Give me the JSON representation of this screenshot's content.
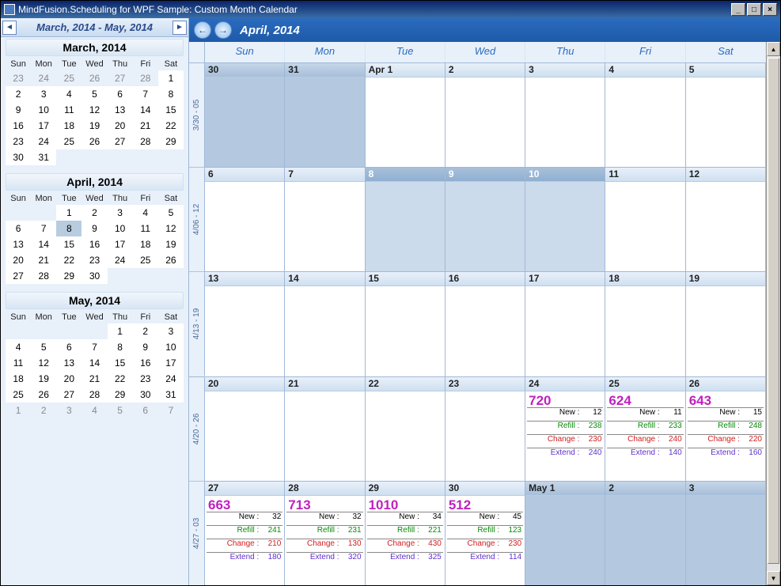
{
  "window": {
    "title": "MindFusion.Scheduling for WPF Sample: Custom Month Calendar"
  },
  "sidebar": {
    "range": "March, 2014 - May, 2014",
    "dow": [
      "Sun",
      "Mon",
      "Tue",
      "Wed",
      "Thu",
      "Fri",
      "Sat"
    ],
    "months": [
      {
        "title": "March, 2014",
        "days": [
          {
            "n": "23",
            "in": false
          },
          {
            "n": "24",
            "in": false
          },
          {
            "n": "25",
            "in": false
          },
          {
            "n": "26",
            "in": false
          },
          {
            "n": "27",
            "in": false
          },
          {
            "n": "28",
            "in": false
          },
          {
            "n": "1",
            "in": true
          },
          {
            "n": "2",
            "in": true
          },
          {
            "n": "3",
            "in": true
          },
          {
            "n": "4",
            "in": true
          },
          {
            "n": "5",
            "in": true
          },
          {
            "n": "6",
            "in": true
          },
          {
            "n": "7",
            "in": true
          },
          {
            "n": "8",
            "in": true
          },
          {
            "n": "9",
            "in": true
          },
          {
            "n": "10",
            "in": true
          },
          {
            "n": "11",
            "in": true
          },
          {
            "n": "12",
            "in": true
          },
          {
            "n": "13",
            "in": true
          },
          {
            "n": "14",
            "in": true
          },
          {
            "n": "15",
            "in": true
          },
          {
            "n": "16",
            "in": true
          },
          {
            "n": "17",
            "in": true
          },
          {
            "n": "18",
            "in": true
          },
          {
            "n": "19",
            "in": true
          },
          {
            "n": "20",
            "in": true
          },
          {
            "n": "21",
            "in": true
          },
          {
            "n": "22",
            "in": true
          },
          {
            "n": "23",
            "in": true
          },
          {
            "n": "24",
            "in": true
          },
          {
            "n": "25",
            "in": true
          },
          {
            "n": "26",
            "in": true
          },
          {
            "n": "27",
            "in": true
          },
          {
            "n": "28",
            "in": true
          },
          {
            "n": "29",
            "in": true
          },
          {
            "n": "30",
            "in": true
          },
          {
            "n": "31",
            "in": true
          },
          {
            "n": "",
            "in": false
          },
          {
            "n": "",
            "in": false
          },
          {
            "n": "",
            "in": false
          },
          {
            "n": "",
            "in": false
          },
          {
            "n": "",
            "in": false
          }
        ]
      },
      {
        "title": "April, 2014",
        "days": [
          {
            "n": "",
            "in": false
          },
          {
            "n": "",
            "in": false
          },
          {
            "n": "1",
            "in": true
          },
          {
            "n": "2",
            "in": true
          },
          {
            "n": "3",
            "in": true
          },
          {
            "n": "4",
            "in": true
          },
          {
            "n": "5",
            "in": true
          },
          {
            "n": "6",
            "in": true
          },
          {
            "n": "7",
            "in": true
          },
          {
            "n": "8",
            "in": true,
            "today": true
          },
          {
            "n": "9",
            "in": true
          },
          {
            "n": "10",
            "in": true
          },
          {
            "n": "11",
            "in": true
          },
          {
            "n": "12",
            "in": true
          },
          {
            "n": "13",
            "in": true
          },
          {
            "n": "14",
            "in": true
          },
          {
            "n": "15",
            "in": true
          },
          {
            "n": "16",
            "in": true
          },
          {
            "n": "17",
            "in": true
          },
          {
            "n": "18",
            "in": true
          },
          {
            "n": "19",
            "in": true
          },
          {
            "n": "20",
            "in": true
          },
          {
            "n": "21",
            "in": true
          },
          {
            "n": "22",
            "in": true
          },
          {
            "n": "23",
            "in": true
          },
          {
            "n": "24",
            "in": true
          },
          {
            "n": "25",
            "in": true
          },
          {
            "n": "26",
            "in": true
          },
          {
            "n": "27",
            "in": true
          },
          {
            "n": "28",
            "in": true
          },
          {
            "n": "29",
            "in": true
          },
          {
            "n": "30",
            "in": true
          },
          {
            "n": "",
            "in": false
          },
          {
            "n": "",
            "in": false
          },
          {
            "n": "",
            "in": false
          }
        ]
      },
      {
        "title": "May, 2014",
        "days": [
          {
            "n": "",
            "in": false
          },
          {
            "n": "",
            "in": false
          },
          {
            "n": "",
            "in": false
          },
          {
            "n": "",
            "in": false
          },
          {
            "n": "1",
            "in": true
          },
          {
            "n": "2",
            "in": true
          },
          {
            "n": "3",
            "in": true
          },
          {
            "n": "4",
            "in": true
          },
          {
            "n": "5",
            "in": true
          },
          {
            "n": "6",
            "in": true
          },
          {
            "n": "7",
            "in": true
          },
          {
            "n": "8",
            "in": true
          },
          {
            "n": "9",
            "in": true
          },
          {
            "n": "10",
            "in": true
          },
          {
            "n": "11",
            "in": true
          },
          {
            "n": "12",
            "in": true
          },
          {
            "n": "13",
            "in": true
          },
          {
            "n": "14",
            "in": true
          },
          {
            "n": "15",
            "in": true
          },
          {
            "n": "16",
            "in": true
          },
          {
            "n": "17",
            "in": true
          },
          {
            "n": "18",
            "in": true
          },
          {
            "n": "19",
            "in": true
          },
          {
            "n": "20",
            "in": true
          },
          {
            "n": "21",
            "in": true
          },
          {
            "n": "22",
            "in": true
          },
          {
            "n": "23",
            "in": true
          },
          {
            "n": "24",
            "in": true
          },
          {
            "n": "25",
            "in": true
          },
          {
            "n": "26",
            "in": true
          },
          {
            "n": "27",
            "in": true
          },
          {
            "n": "28",
            "in": true
          },
          {
            "n": "29",
            "in": true
          },
          {
            "n": "30",
            "in": true
          },
          {
            "n": "31",
            "in": true
          },
          {
            "n": "1",
            "in": false
          },
          {
            "n": "2",
            "in": false
          },
          {
            "n": "3",
            "in": false
          },
          {
            "n": "4",
            "in": false
          },
          {
            "n": "5",
            "in": false
          },
          {
            "n": "6",
            "in": false
          },
          {
            "n": "7",
            "in": false
          }
        ]
      }
    ]
  },
  "main": {
    "title": "April, 2014",
    "dow": [
      "Sun",
      "Mon",
      "Tue",
      "Wed",
      "Thu",
      "Fri",
      "Sat"
    ],
    "weeks": [
      {
        "label": "3/30 - 05",
        "cells": [
          {
            "h": "30",
            "out": true
          },
          {
            "h": "31",
            "out": true
          },
          {
            "h": "Apr 1"
          },
          {
            "h": "2"
          },
          {
            "h": "3"
          },
          {
            "h": "4"
          },
          {
            "h": "5"
          }
        ]
      },
      {
        "label": "4/06 - 12",
        "cells": [
          {
            "h": "6"
          },
          {
            "h": "7"
          },
          {
            "h": "8",
            "shade": true
          },
          {
            "h": "9",
            "shade": true
          },
          {
            "h": "10",
            "shade": true
          },
          {
            "h": "11"
          },
          {
            "h": "12"
          }
        ]
      },
      {
        "label": "4/13 - 19",
        "cells": [
          {
            "h": "13"
          },
          {
            "h": "14"
          },
          {
            "h": "15"
          },
          {
            "h": "16"
          },
          {
            "h": "17"
          },
          {
            "h": "18"
          },
          {
            "h": "19"
          }
        ]
      },
      {
        "label": "4/20 - 26",
        "cells": [
          {
            "h": "20"
          },
          {
            "h": "21"
          },
          {
            "h": "22"
          },
          {
            "h": "23"
          },
          {
            "h": "24",
            "big": "720",
            "stats": [
              [
                "New :",
                "12"
              ],
              [
                "Refill :",
                "238"
              ],
              [
                "Change :",
                "230"
              ],
              [
                "Extend :",
                "240"
              ]
            ]
          },
          {
            "h": "25",
            "big": "624",
            "stats": [
              [
                "New :",
                "11"
              ],
              [
                "Refill :",
                "233"
              ],
              [
                "Change :",
                "240"
              ],
              [
                "Extend :",
                "140"
              ]
            ]
          },
          {
            "h": "26",
            "big": "643",
            "stats": [
              [
                "New :",
                "15"
              ],
              [
                "Refill :",
                "248"
              ],
              [
                "Change :",
                "220"
              ],
              [
                "Extend :",
                "160"
              ]
            ]
          }
        ]
      },
      {
        "label": "4/27 - 03",
        "cells": [
          {
            "h": "27",
            "big": "663",
            "stats": [
              [
                "New :",
                "32"
              ],
              [
                "Refill :",
                "241"
              ],
              [
                "Change :",
                "210"
              ],
              [
                "Extend :",
                "180"
              ]
            ]
          },
          {
            "h": "28",
            "big": "713",
            "stats": [
              [
                "New :",
                "32"
              ],
              [
                "Refill :",
                "231"
              ],
              [
                "Change :",
                "130"
              ],
              [
                "Extend :",
                "320"
              ]
            ]
          },
          {
            "h": "29",
            "big": "1010",
            "stats": [
              [
                "New :",
                "34"
              ],
              [
                "Refill :",
                "221"
              ],
              [
                "Change :",
                "430"
              ],
              [
                "Extend :",
                "325"
              ]
            ]
          },
          {
            "h": "30",
            "big": "512",
            "stats": [
              [
                "New :",
                "45"
              ],
              [
                "Refill :",
                "123"
              ],
              [
                "Change :",
                "230"
              ],
              [
                "Extend :",
                "114"
              ]
            ]
          },
          {
            "h": "May 1",
            "out": true
          },
          {
            "h": "2",
            "out": true
          },
          {
            "h": "3",
            "out": true
          }
        ]
      }
    ],
    "stat_classes": [
      "new",
      "refill",
      "change",
      "extend"
    ]
  }
}
